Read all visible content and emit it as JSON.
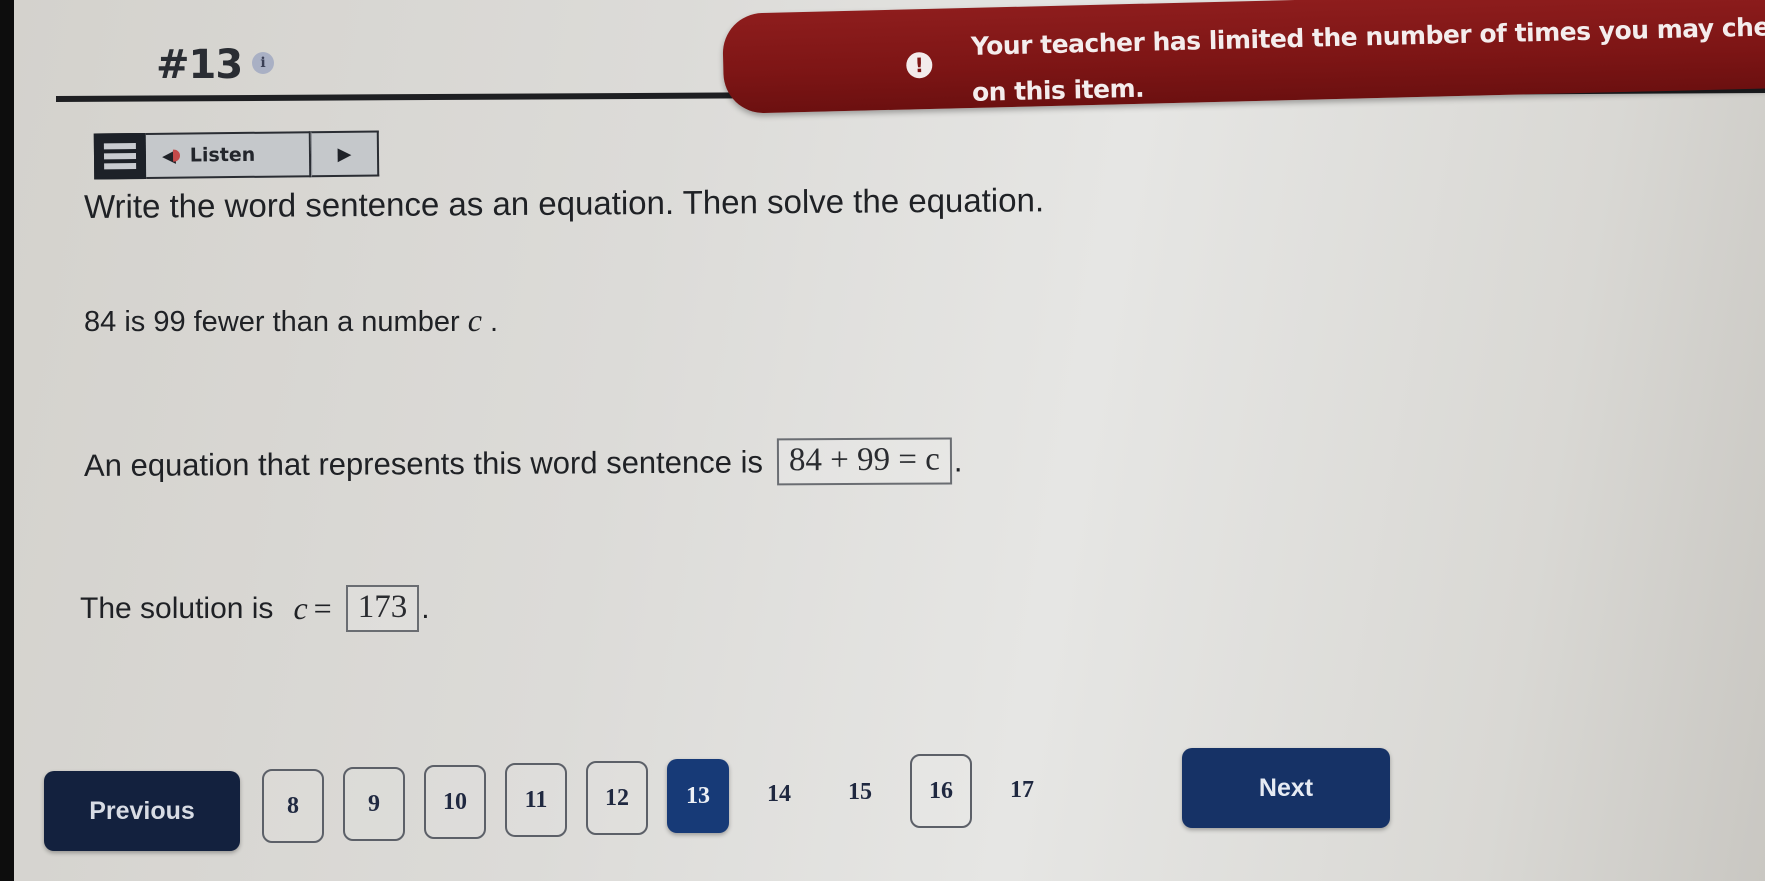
{
  "header": {
    "item_number": "#13",
    "info_icon": "i"
  },
  "alert": {
    "icon": "!",
    "line1": "Your teacher has limited the number of times you may check yo",
    "line2": "on this item.",
    "color": "#7d1515"
  },
  "toolbar": {
    "listen_label": "Listen",
    "speaker_icon": "◀",
    "play_icon": "▶"
  },
  "question": {
    "instruction": "Write the word sentence as an equation. Then solve the equation.",
    "problem_text": "84 is 99 fewer than a number",
    "problem_var": "c",
    "problem_end": " .",
    "equation_prompt": "An equation that represents this word sentence is",
    "equation_answer": "84 + 99 = c",
    "solution_prompt": "The solution is",
    "solution_var": "c",
    "solution_eq": "=",
    "solution_answer": "173",
    "period": "."
  },
  "navigation": {
    "previous_label": "Previous",
    "next_label": "Next",
    "pages": [
      {
        "label": "8",
        "state": "visited"
      },
      {
        "label": "9",
        "state": "visited"
      },
      {
        "label": "10",
        "state": "visited"
      },
      {
        "label": "11",
        "state": "visited"
      },
      {
        "label": "12",
        "state": "visited"
      },
      {
        "label": "13",
        "state": "current"
      },
      {
        "label": "14",
        "state": "unvisited"
      },
      {
        "label": "15",
        "state": "unvisited"
      },
      {
        "label": "16",
        "state": "visited"
      },
      {
        "label": "17",
        "state": "unvisited"
      }
    ],
    "current_color": "#173a77",
    "button_color": "#13213e"
  }
}
